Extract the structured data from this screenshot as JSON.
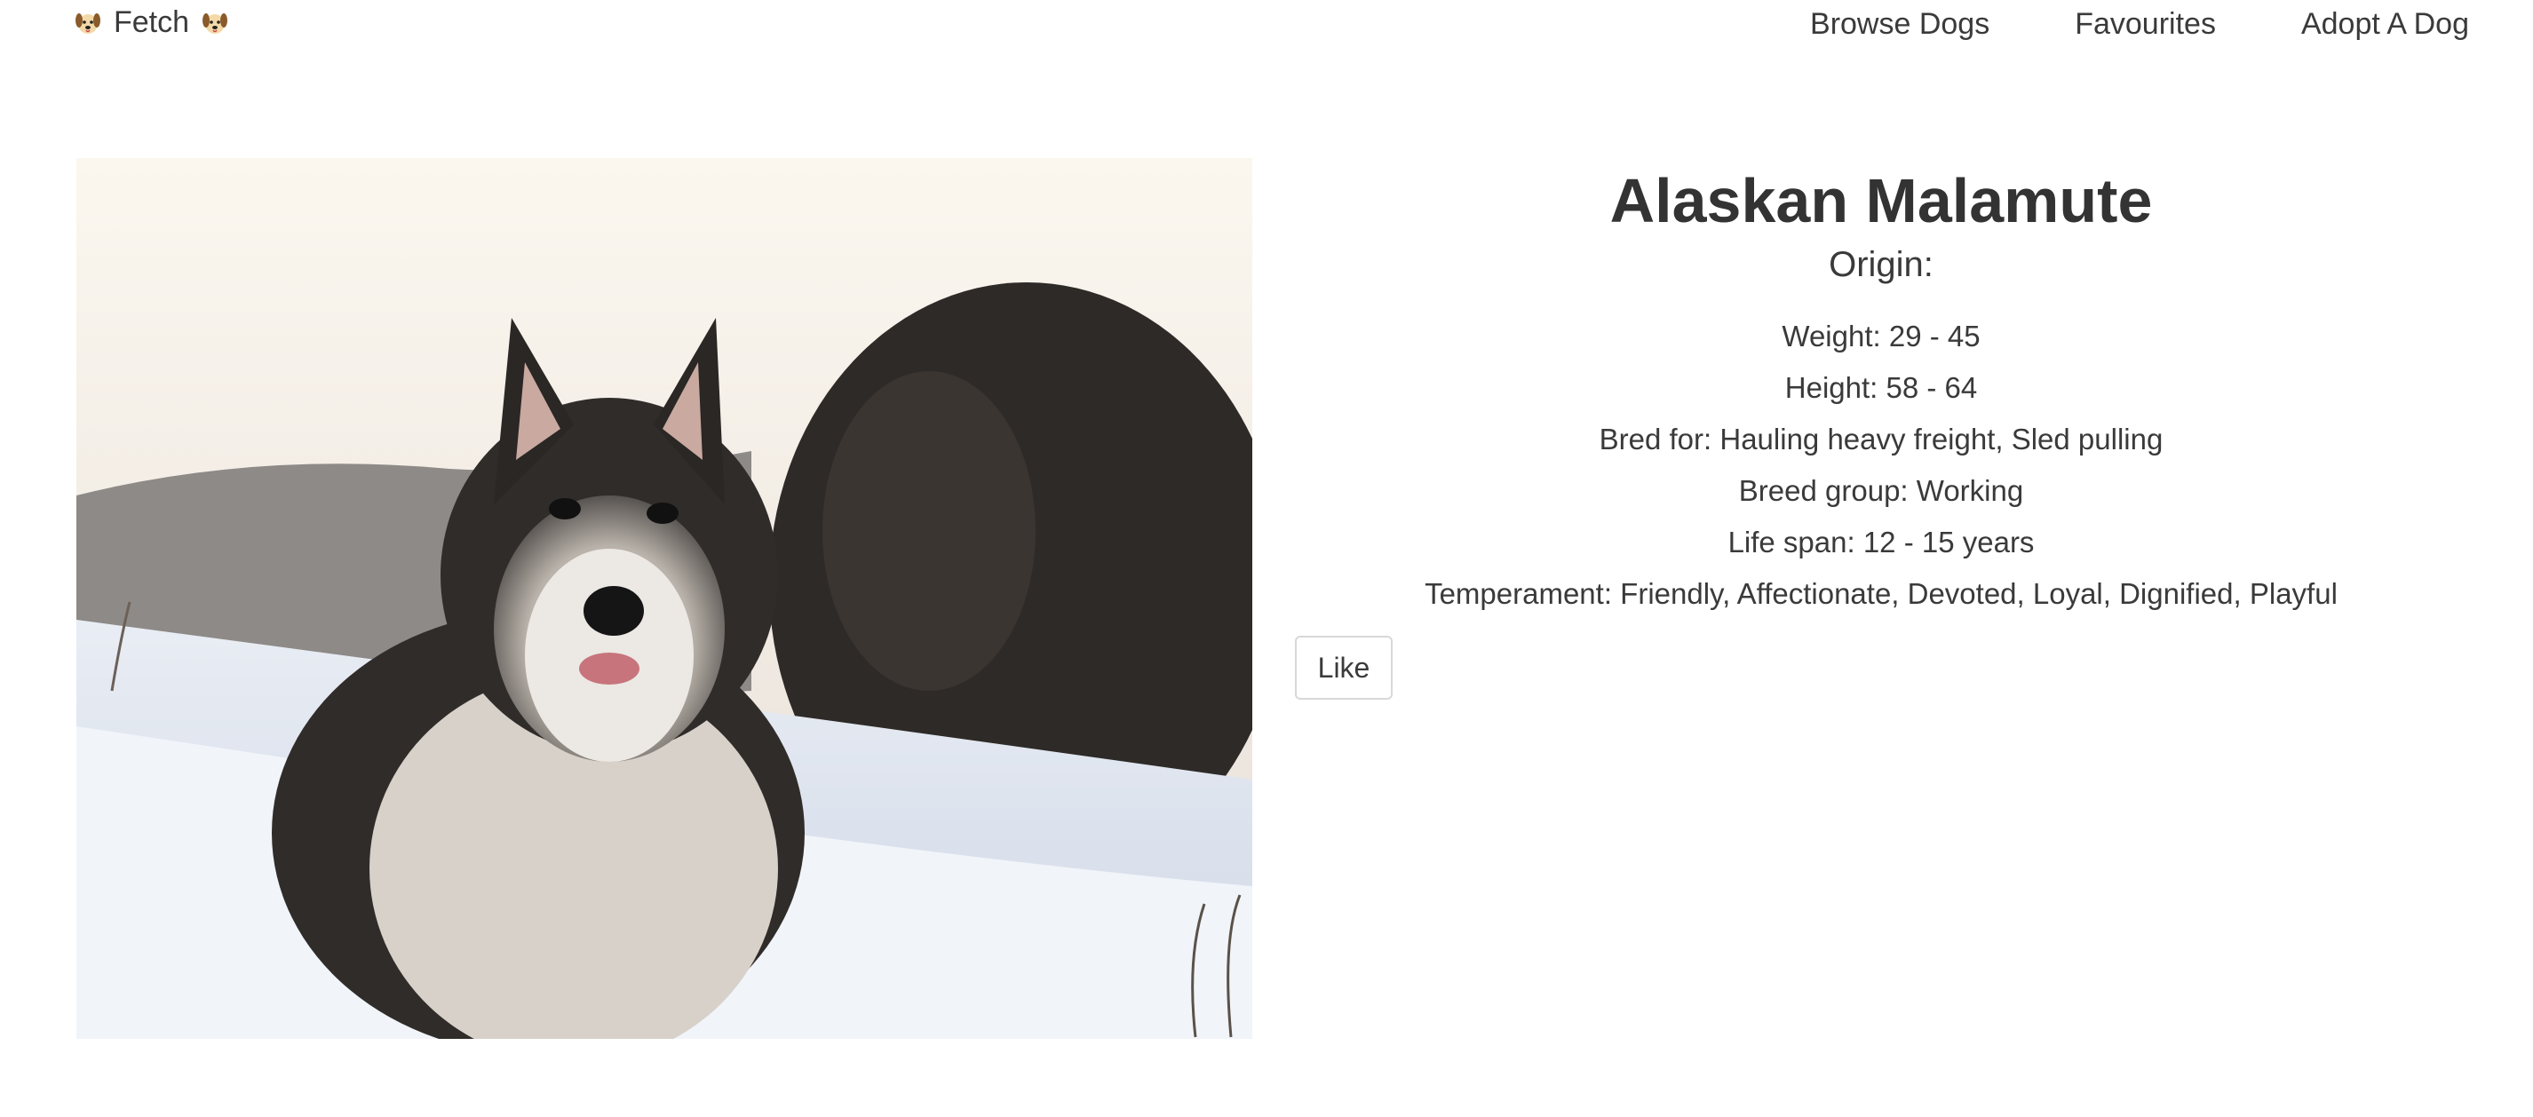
{
  "nav": {
    "brand_label": "Fetch",
    "brand_icon": "dog-face-icon",
    "links": [
      {
        "label": "Browse Dogs"
      },
      {
        "label": "Favourites"
      },
      {
        "label": "Adopt A Dog"
      }
    ]
  },
  "dog": {
    "name": "Alaskan Malamute",
    "origin": "Origin:",
    "weight": "Weight: 29 - 45",
    "height": "Height: 58 - 64",
    "bred_for": "Bred for: Hauling heavy freight, Sled pulling",
    "breed_group": "Breed group: Working",
    "life_span": "Life span: 12 - 15 years",
    "temperament": "Temperament: Friendly, Affectionate, Devoted, Loyal, Dignified, Playful",
    "photo": "alaskan-malamute-in-snow"
  },
  "actions": {
    "like_label": "Like"
  },
  "colors": {
    "text": "#3a3a3a",
    "background": "#ffffff",
    "button_border": "#d8d8d8"
  }
}
